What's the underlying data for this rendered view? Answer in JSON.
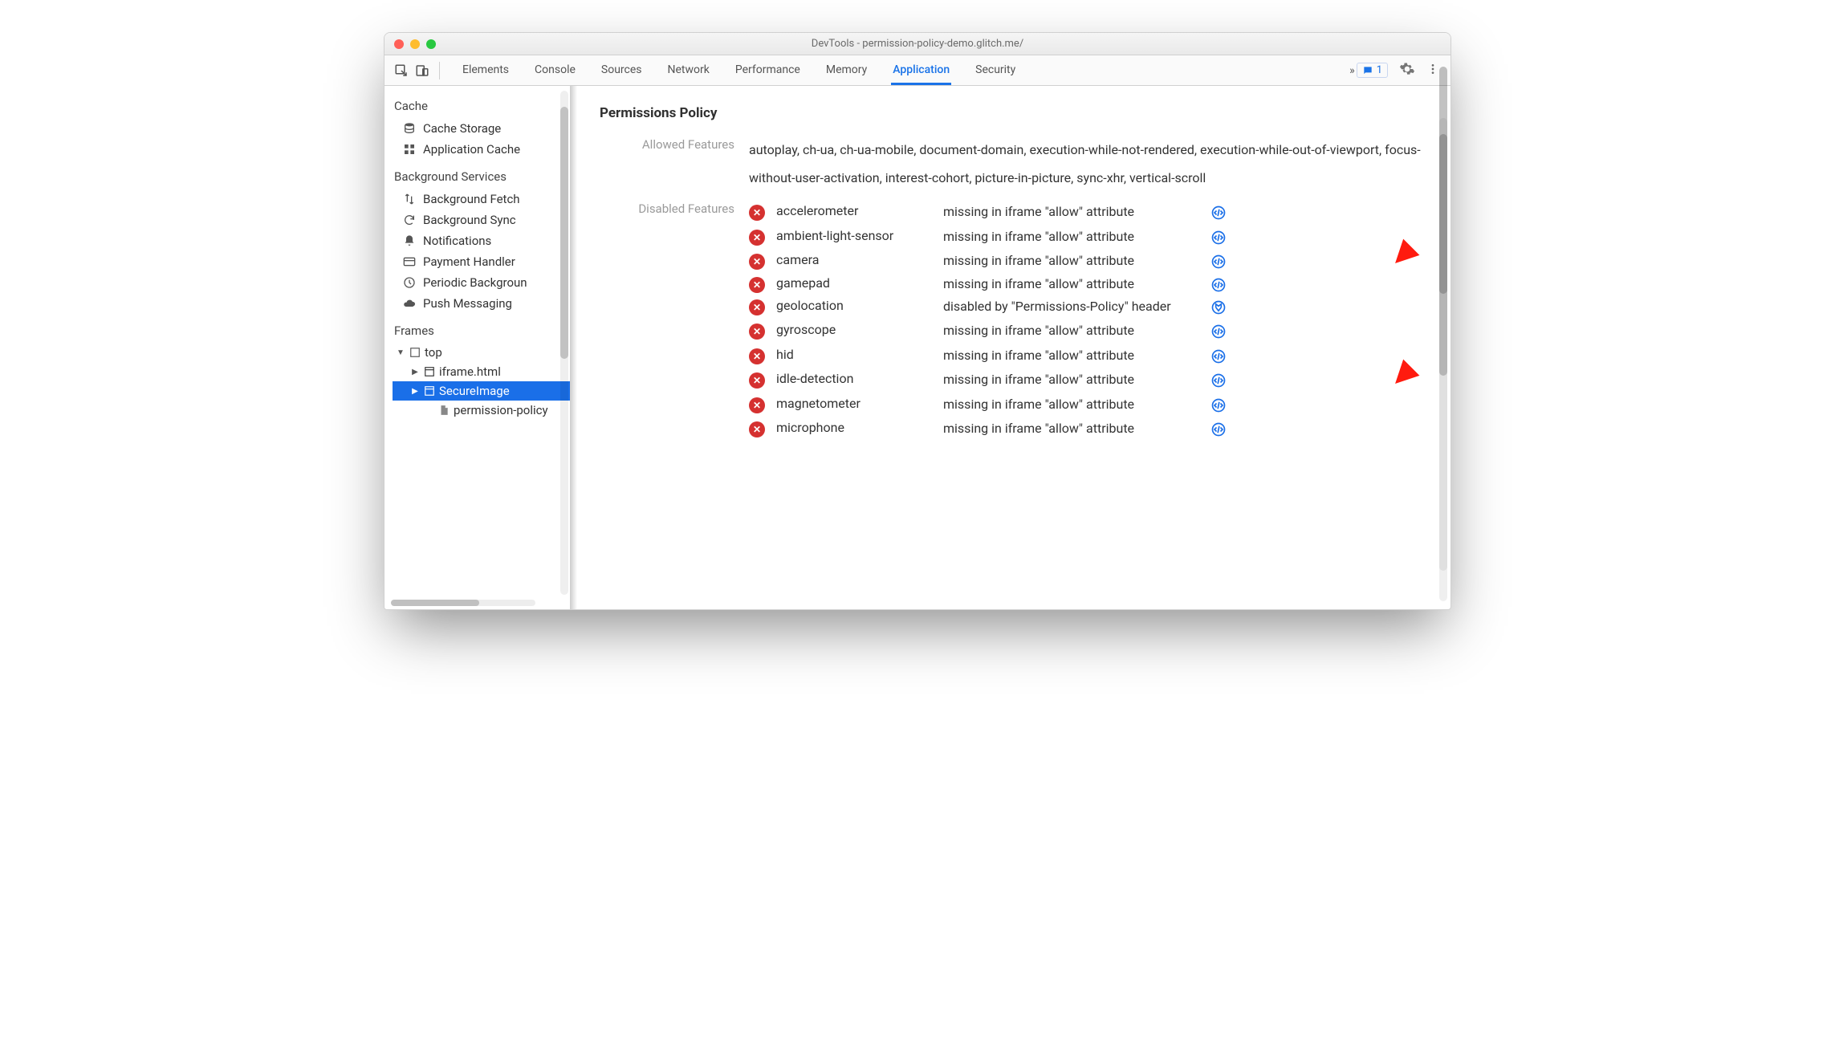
{
  "window": {
    "title": "DevTools - permission-policy-demo.glitch.me/"
  },
  "toolbar": {
    "chip_count": "1",
    "overflow_glyph": "»"
  },
  "tabs": [
    {
      "label": "Elements"
    },
    {
      "label": "Console"
    },
    {
      "label": "Sources"
    },
    {
      "label": "Network"
    },
    {
      "label": "Performance"
    },
    {
      "label": "Memory"
    },
    {
      "label": "Application",
      "active": true
    },
    {
      "label": "Security"
    }
  ],
  "sidebar": {
    "sections": [
      {
        "title": "Cache",
        "items": [
          {
            "icon": "db",
            "label": "Cache Storage"
          },
          {
            "icon": "grid",
            "label": "Application Cache"
          }
        ]
      },
      {
        "title": "Background Services",
        "items": [
          {
            "icon": "updown",
            "label": "Background Fetch"
          },
          {
            "icon": "sync",
            "label": "Background Sync"
          },
          {
            "icon": "bell",
            "label": "Notifications"
          },
          {
            "icon": "card",
            "label": "Payment Handler"
          },
          {
            "icon": "clock",
            "label": "Periodic Backgroun"
          },
          {
            "icon": "cloud",
            "label": "Push Messaging"
          }
        ]
      }
    ],
    "frames": {
      "title": "Frames",
      "tree": [
        {
          "level": 0,
          "twist": "▼",
          "icon": "frame",
          "label": "top"
        },
        {
          "level": 1,
          "twist": "▶",
          "icon": "iframe",
          "label": "iframe.html"
        },
        {
          "level": 1,
          "twist": "▶",
          "icon": "iframe",
          "label": "SecureImage",
          "selected": true
        },
        {
          "level": 2,
          "twist": "",
          "icon": "doc",
          "label": "permission-policy"
        }
      ]
    }
  },
  "panel": {
    "title": "Permissions Policy",
    "allowed": {
      "label": "Allowed Features",
      "value": "autoplay, ch-ua, ch-ua-mobile, document-domain, execution-while-not-rendered, execution-while-out-of-viewport, focus-without-user-activation, interest-cohort, picture-in-picture, sync-xhr, vertical-scroll"
    },
    "disabled": {
      "label": "Disabled Features",
      "rows": [
        {
          "name": "accelerometer",
          "reason": "missing in iframe \"allow\" attribute",
          "link": "code"
        },
        {
          "name": "ambient-light-sensor",
          "reason": "missing in iframe \"allow\" attribute",
          "link": "code"
        },
        {
          "name": "camera",
          "reason": "missing in iframe \"allow\" attribute",
          "link": "code"
        },
        {
          "name": "gamepad",
          "reason": "missing in iframe \"allow\" attribute",
          "link": "code"
        },
        {
          "name": "geolocation",
          "reason": "disabled by \"Permissions-Policy\" header",
          "link": "net"
        },
        {
          "name": "gyroscope",
          "reason": "missing in iframe \"allow\" attribute",
          "link": "code"
        },
        {
          "name": "hid",
          "reason": "missing in iframe \"allow\" attribute",
          "link": "code"
        },
        {
          "name": "idle-detection",
          "reason": "missing in iframe \"allow\" attribute",
          "link": "code"
        },
        {
          "name": "magnetometer",
          "reason": "missing in iframe \"allow\" attribute",
          "link": "code"
        },
        {
          "name": "microphone",
          "reason": "missing in iframe \"allow\" attribute",
          "link": "code"
        }
      ]
    }
  }
}
